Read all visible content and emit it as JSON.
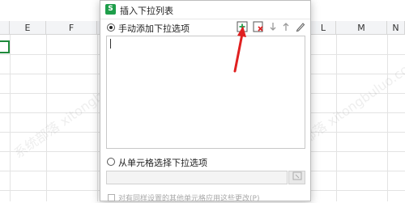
{
  "spreadsheet": {
    "columns": [
      {
        "name": "col-e",
        "label": "E"
      },
      {
        "name": "col-f",
        "label": "F"
      },
      {
        "name": "col-l",
        "label": "L"
      },
      {
        "name": "col-m",
        "label": "M"
      },
      {
        "name": "col-n",
        "label": "N"
      }
    ],
    "selection_color": "#1f8a3b"
  },
  "dialog": {
    "title": "插入下拉列表",
    "app_icon_text": "S",
    "app_icon_color": "#1e9e4a",
    "manual_option_label": "手动添加下拉选项",
    "manual_option_selected": true,
    "toolbar": {
      "add_icon": "add-item-icon",
      "delete_icon": "delete-item-icon",
      "down_icon": "arrow-down-icon",
      "up_icon": "arrow-up-icon",
      "edit_icon": "edit-icon"
    },
    "list_entry_value": "",
    "cell_option_label": "从单元格选择下拉选项",
    "cell_option_selected": false,
    "range_value": "",
    "footer_checkbox_label": "对有同样设置的其他单元格应用这些更改(P)",
    "footer_checkbox_checked": false
  },
  "annotation": {
    "arrow_color": "#e02020"
  },
  "watermark_text": "系统部落 xitongbuluo.com"
}
